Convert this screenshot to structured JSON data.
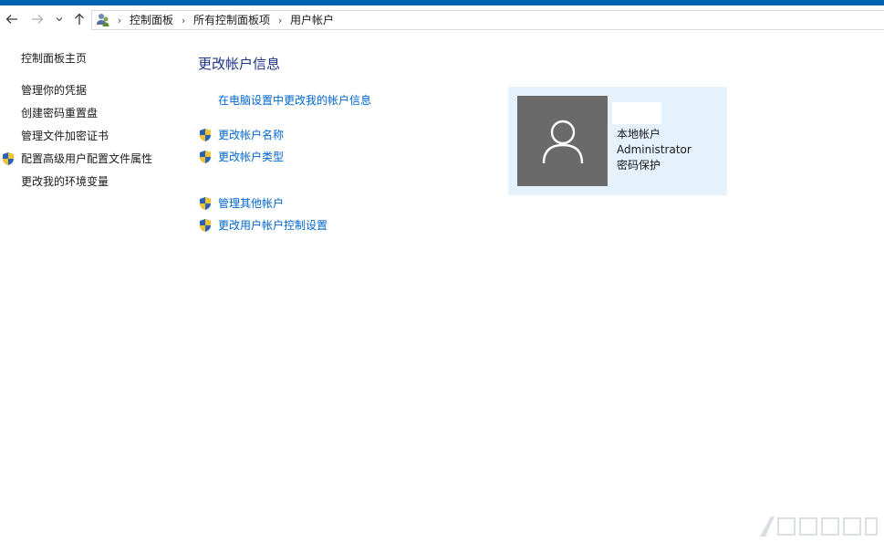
{
  "breadcrumb": {
    "items": [
      "控制面板",
      "所有控制面板项",
      "用户帐户"
    ]
  },
  "sidebar": {
    "items": [
      {
        "label": "控制面板主页",
        "shield": false
      },
      {
        "label": "管理你的凭据",
        "shield": false
      },
      {
        "label": "创建密码重置盘",
        "shield": false
      },
      {
        "label": "管理文件加密证书",
        "shield": false
      },
      {
        "label": "配置高级用户配置文件属性",
        "shield": true
      },
      {
        "label": "更改我的环境变量",
        "shield": false
      }
    ]
  },
  "main": {
    "title": "更改帐户信息",
    "links": [
      {
        "label": "在电脑设置中更改我的帐户信息",
        "shield": false
      },
      {
        "label": "更改帐户名称",
        "shield": true
      },
      {
        "label": "更改帐户类型",
        "shield": true
      },
      {
        "label": "管理其他帐户",
        "shield": true
      },
      {
        "label": "更改用户帐户控制设置",
        "shield": true
      }
    ]
  },
  "account": {
    "type": "本地帐户",
    "group": "Administrator",
    "protection": "密码保护",
    "icon": "user-icon"
  },
  "colors": {
    "accent": "#0063b1",
    "link": "#0066cc",
    "title": "#1e3287",
    "card_bg": "#e5f1fb",
    "avatar_bg": "#6a6a6a"
  }
}
